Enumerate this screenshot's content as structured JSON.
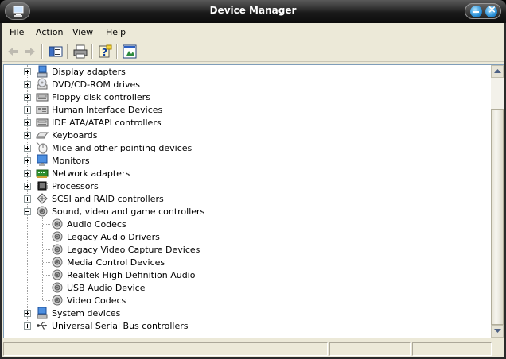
{
  "window": {
    "title": "Device Manager"
  },
  "menu": {
    "items": [
      "File",
      "Action",
      "View",
      "Help"
    ]
  },
  "toolbar": {
    "buttons": [
      {
        "icon": "back-arrow-icon"
      },
      {
        "icon": "forward-arrow-icon"
      },
      {
        "icon": "show-hide-console-tree-icon"
      },
      {
        "icon": "print-icon"
      },
      {
        "icon": "help-icon"
      },
      {
        "icon": "properties-icon"
      }
    ]
  },
  "tree": {
    "categories": [
      {
        "label": "Display adapters",
        "icon": "display-adapter-icon",
        "expanded": false
      },
      {
        "label": "DVD/CD-ROM drives",
        "icon": "cdrom-icon",
        "expanded": false
      },
      {
        "label": "Floppy disk controllers",
        "icon": "floppy-controller-icon",
        "expanded": false
      },
      {
        "label": "Human Interface Devices",
        "icon": "hid-icon",
        "expanded": false
      },
      {
        "label": "IDE ATA/ATAPI controllers",
        "icon": "ide-controller-icon",
        "expanded": false
      },
      {
        "label": "Keyboards",
        "icon": "keyboard-icon",
        "expanded": false
      },
      {
        "label": "Mice and other pointing devices",
        "icon": "mouse-icon",
        "expanded": false
      },
      {
        "label": "Monitors",
        "icon": "monitor-icon",
        "expanded": false
      },
      {
        "label": "Network adapters",
        "icon": "network-adapter-icon",
        "expanded": false
      },
      {
        "label": "Processors",
        "icon": "processor-icon",
        "expanded": false
      },
      {
        "label": "SCSI and RAID controllers",
        "icon": "scsi-icon",
        "expanded": false
      },
      {
        "label": "Sound, video and game controllers",
        "icon": "speaker-icon",
        "expanded": true,
        "children": [
          "Audio Codecs",
          "Legacy Audio Drivers",
          "Legacy Video Capture Devices",
          "Media Control Devices",
          "Realtek High Definition Audio",
          "USB Audio Device",
          "Video Codecs"
        ]
      },
      {
        "label": "System devices",
        "icon": "system-device-icon",
        "expanded": false
      },
      {
        "label": "Universal Serial Bus controllers",
        "icon": "usb-icon",
        "expanded": false
      }
    ]
  },
  "colors": {
    "title_bar": "#1a1a1a",
    "control_buttons": "#2a8fd6",
    "client_bg": "#ece9d8",
    "tree_border": "#7f9db9"
  }
}
